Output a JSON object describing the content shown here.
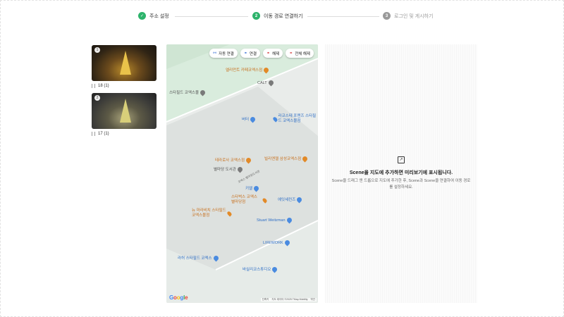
{
  "stepper": {
    "steps": [
      {
        "label": "주소 설정",
        "icon": "check-icon",
        "state": "done"
      },
      {
        "label": "이동 경로 연결하기",
        "number": "2",
        "state": "active"
      },
      {
        "label": "로그인 및 게시하기",
        "number": "3",
        "state": "pending"
      }
    ],
    "check_glyph": "✓"
  },
  "scenes": [
    {
      "badge": "1",
      "label": "18 (1)",
      "icon": "bars-icon"
    },
    {
      "badge": "2",
      "label": "17 (1)",
      "icon": "bars-icon"
    }
  ],
  "map": {
    "buttons": [
      {
        "label": "자동 연결",
        "icon": "auto-link-icon"
      },
      {
        "label": "연결",
        "icon": "link-icon"
      },
      {
        "label": "해제",
        "icon": "unlink-icon"
      },
      {
        "label": "전체 해제",
        "icon": "unlink-all-icon"
      }
    ],
    "pois": [
      {
        "label": "엘리먼트 카페코엑스점",
        "color": "orange"
      },
      {
        "label": "CALT",
        "color": "gray"
      },
      {
        "label": "스타필드 코엑스몰",
        "color": "gray"
      },
      {
        "label": "버터",
        "color": "blue"
      },
      {
        "label": "라코스테 포맨즈 스타필드 코엑스몰점",
        "color": "blue"
      },
      {
        "label": "테라로사 코엑스점",
        "color": "orange"
      },
      {
        "label": "빌리엔젤 삼성코엑스점",
        "color": "orange"
      },
      {
        "label": "별마당 도서관",
        "color": "gray"
      },
      {
        "label": "키엘",
        "color": "blue"
      },
      {
        "label": "스타벅스 코엑스 별마당점",
        "color": "orange"
      },
      {
        "label": "에잇세컨즈",
        "color": "blue"
      },
      {
        "label": "뉴 마라비치 스타필드 코엑스몰점",
        "color": "orange"
      },
      {
        "label": "Stuart Weitzman",
        "color": "blue"
      },
      {
        "label": "LIFEWORK",
        "color": "blue"
      },
      {
        "label": "라허 스타필드 코엑스",
        "color": "blue"
      },
      {
        "label": "바실리코스튜디오",
        "color": "blue"
      }
    ],
    "street_label": "코엑스 별마당도서관",
    "google_letters": [
      "G",
      "o",
      "o",
      "g",
      "l",
      "e"
    ],
    "attribution": [
      "단축키",
      "지도 데이터 ©2025 TMap Mobility",
      "약관"
    ]
  },
  "preview": {
    "title": "Scene을 지도에 추가하면 미리보기에 표시됩니다.",
    "description": "Scene을 드래그 앤 드롭으로 지도에 추가한 후, Scene과 Scene을 연결하여 이동 경로를 설정하세요."
  },
  "colors": {
    "accent_green": "#2db36b",
    "pending_gray": "#9a9a9a",
    "poi_orange": "#e28a28",
    "poi_blue": "#4a8be0"
  }
}
